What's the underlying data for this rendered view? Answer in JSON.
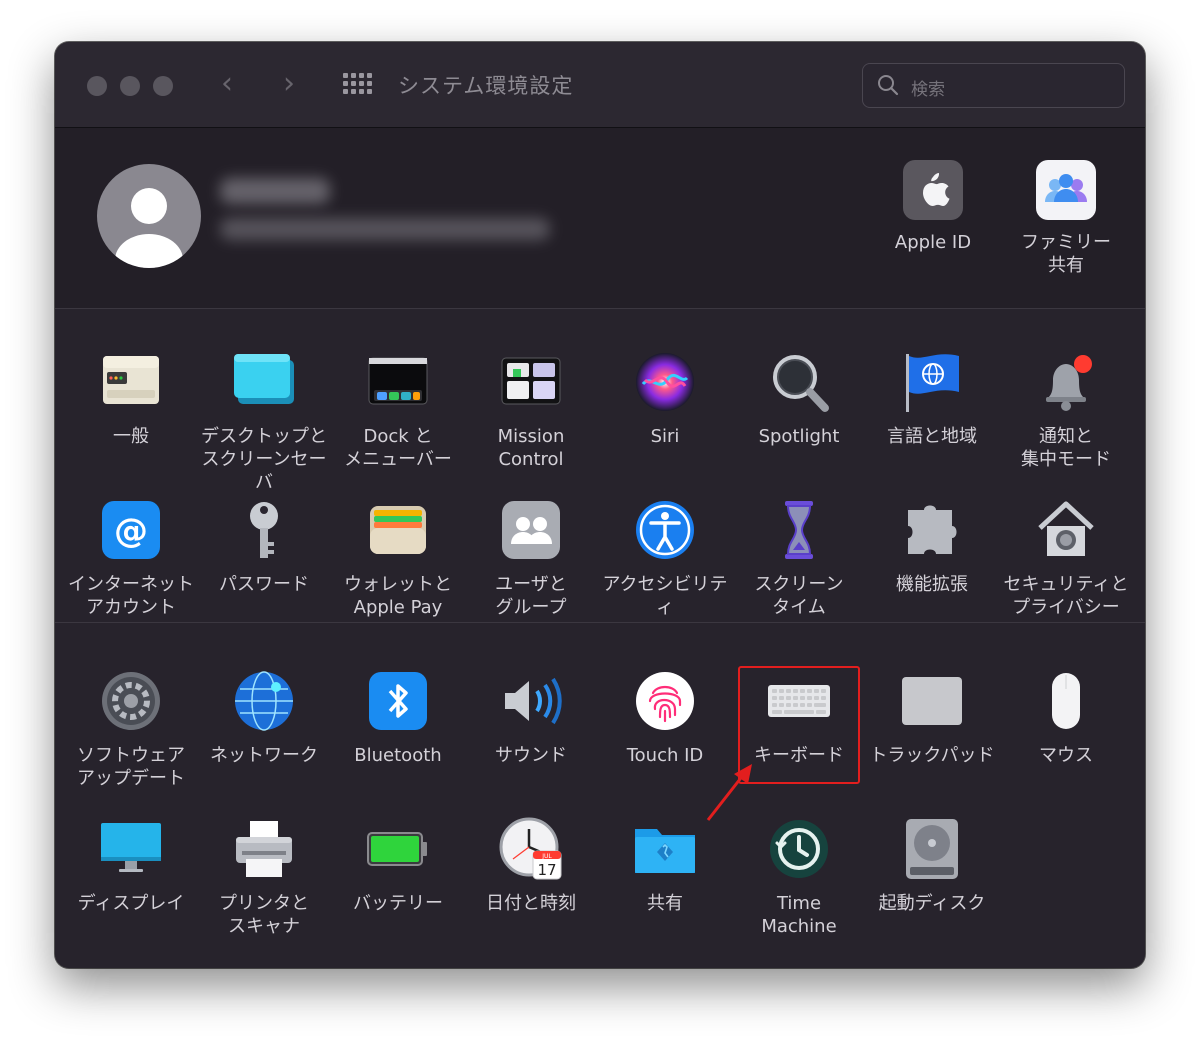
{
  "window": {
    "title": "システム環境設定",
    "search_placeholder": "検索"
  },
  "account": {
    "top_items": [
      {
        "label": "Apple ID",
        "icon": "apple-id-icon"
      },
      {
        "label": "ファミリー\n共有",
        "icon": "family-sharing-icon"
      }
    ]
  },
  "prefs_row1": [
    {
      "label": "一般",
      "icon": "general-icon"
    },
    {
      "label": "デスクトップと\nスクリーンセーバ",
      "icon": "desktop-screensaver-icon"
    },
    {
      "label": "Dock と\nメニューバー",
      "icon": "dock-menubar-icon"
    },
    {
      "label": "Mission\nControl",
      "icon": "mission-control-icon"
    },
    {
      "label": "Siri",
      "icon": "siri-icon"
    },
    {
      "label": "Spotlight",
      "icon": "spotlight-icon"
    },
    {
      "label": "言語と地域",
      "icon": "language-region-icon"
    },
    {
      "label": "通知と\n集中モード",
      "icon": "notifications-focus-icon"
    }
  ],
  "prefs_row2": [
    {
      "label": "インターネット\nアカウント",
      "icon": "internet-accounts-icon"
    },
    {
      "label": "パスワード",
      "icon": "passwords-icon"
    },
    {
      "label": "ウォレットと\nApple Pay",
      "icon": "wallet-applepay-icon"
    },
    {
      "label": "ユーザと\nグループ",
      "icon": "users-groups-icon"
    },
    {
      "label": "アクセシビリティ",
      "icon": "accessibility-icon"
    },
    {
      "label": "スクリーン\nタイム",
      "icon": "screen-time-icon"
    },
    {
      "label": "機能拡張",
      "icon": "extensions-icon"
    },
    {
      "label": "セキュリティと\nプライバシー",
      "icon": "security-privacy-icon"
    }
  ],
  "prefs_row3": [
    {
      "label": "ソフトウェア\nアップデート",
      "icon": "software-update-icon"
    },
    {
      "label": "ネットワーク",
      "icon": "network-icon"
    },
    {
      "label": "Bluetooth",
      "icon": "bluetooth-icon"
    },
    {
      "label": "サウンド",
      "icon": "sound-icon"
    },
    {
      "label": "Touch ID",
      "icon": "touch-id-icon"
    },
    {
      "label": "キーボード",
      "icon": "keyboard-icon"
    },
    {
      "label": "トラックパッド",
      "icon": "trackpad-icon"
    },
    {
      "label": "マウス",
      "icon": "mouse-icon"
    }
  ],
  "prefs_row4": [
    {
      "label": "ディスプレイ",
      "icon": "displays-icon"
    },
    {
      "label": "プリンタと\nスキャナ",
      "icon": "printers-scanners-icon"
    },
    {
      "label": "バッテリー",
      "icon": "battery-icon"
    },
    {
      "label": "日付と時刻",
      "icon": "date-time-icon"
    },
    {
      "label": "共有",
      "icon": "sharing-icon"
    },
    {
      "label": "Time\nMachine",
      "icon": "time-machine-icon"
    },
    {
      "label": "起動ディスク",
      "icon": "startup-disk-icon"
    }
  ],
  "calendar_icon": {
    "month": "JUL",
    "day": "17"
  },
  "annotation": {
    "highlight_color": "#e21e1e"
  }
}
